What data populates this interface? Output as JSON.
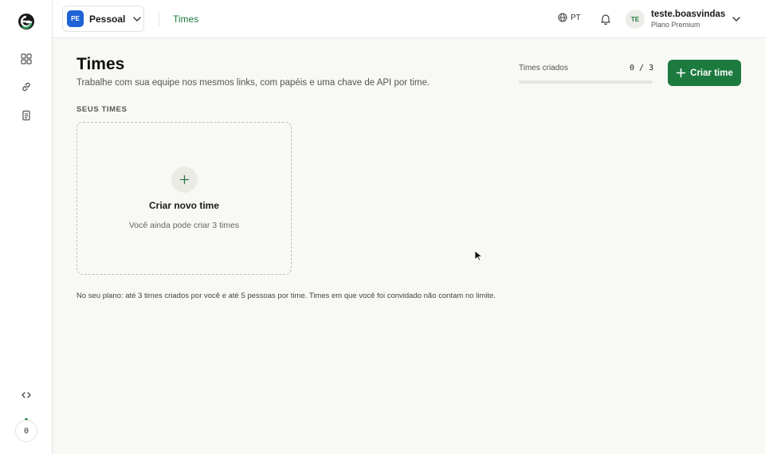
{
  "sidebar": {
    "logo": "e-logo-icon",
    "items": [
      {
        "icon": "dashboard-icon"
      },
      {
        "icon": "link-icon"
      },
      {
        "icon": "document-icon"
      }
    ],
    "code_icon": "code-icon",
    "counter_value": "0"
  },
  "topbar": {
    "workspace": {
      "badge": "PE",
      "label": "Pessoal"
    },
    "nav_link": "Times",
    "language": "PT",
    "user": {
      "initials": "TE",
      "name": "teste.boasvindas",
      "plan": "Plano Premium"
    }
  },
  "main": {
    "title": "Times",
    "subtitle": "Trabalhe com sua equipe nos mesmos links, com papéis e uma chave de API por time.",
    "usage": {
      "label": "Times criados",
      "count_text": "0 / 3",
      "used": 0,
      "limit": 3
    },
    "create_button": "Criar time",
    "section_label": "SEUS TIMES",
    "new_card": {
      "title": "Criar novo time",
      "subtitle": "Você ainda pode criar 3 times"
    },
    "plan_note": "No seu plano: até 3 times criados por você e até 5 pessoas por time. Times em que você foi convidado não contam no limite."
  },
  "colors": {
    "accent": "#1d7a3f",
    "workspace_badge": "#1f63d6",
    "background": "#f8f8f4"
  }
}
